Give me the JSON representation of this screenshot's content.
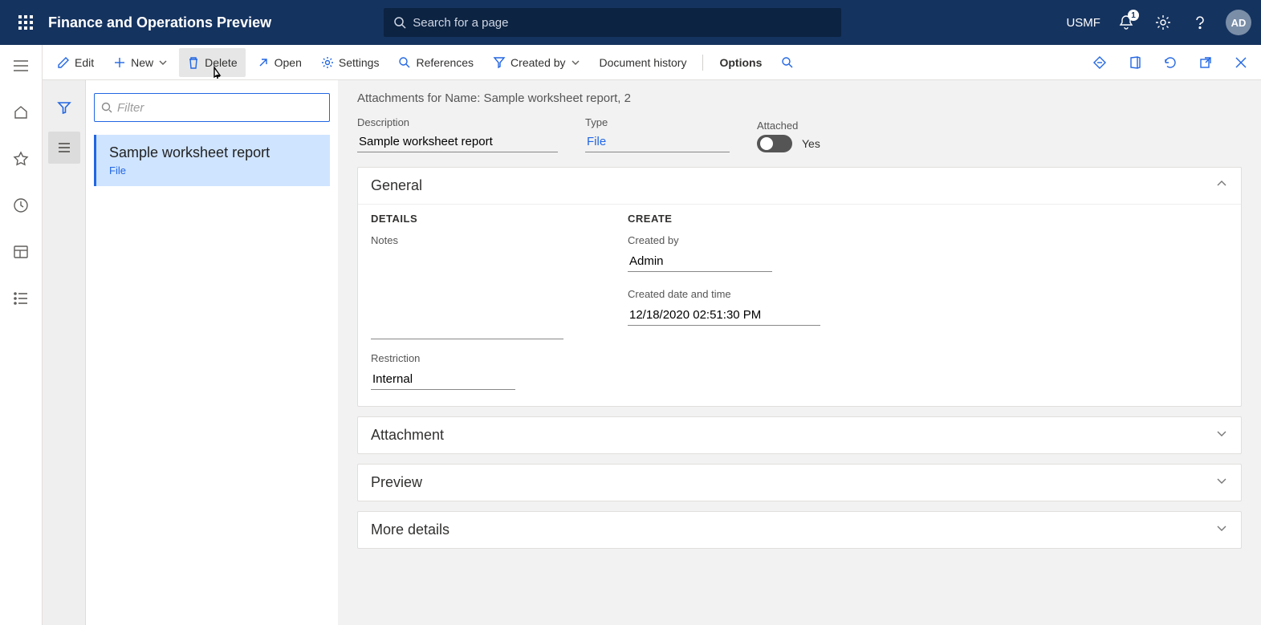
{
  "header": {
    "app_title": "Finance and Operations Preview",
    "search_placeholder": "Search for a page",
    "company": "USMF",
    "avatar": "AD",
    "notification_count": "1"
  },
  "action_pane": {
    "edit": "Edit",
    "new": "New",
    "delete": "Delete",
    "open": "Open",
    "settings": "Settings",
    "references": "References",
    "created_by": "Created by",
    "doc_history": "Document history",
    "options": "Options"
  },
  "list": {
    "filter_placeholder": "Filter",
    "items": [
      {
        "title": "Sample worksheet report",
        "sub": "File"
      }
    ]
  },
  "detail": {
    "page_title": "Attachments for Name: Sample worksheet report, 2",
    "fields": {
      "description_label": "Description",
      "description_value": "Sample worksheet report",
      "type_label": "Type",
      "type_value": "File",
      "attached_label": "Attached",
      "attached_text": "Yes"
    },
    "fasttabs": {
      "general": {
        "title": "General",
        "details_heading": "DETAILS",
        "notes_label": "Notes",
        "notes_value": "",
        "restriction_label": "Restriction",
        "restriction_value": "Internal",
        "create_heading": "CREATE",
        "created_by_label": "Created by",
        "created_by_value": "Admin",
        "created_dt_label": "Created date and time",
        "created_dt_value": "12/18/2020 02:51:30 PM"
      },
      "attachment": "Attachment",
      "preview": "Preview",
      "more_details": "More details"
    }
  }
}
